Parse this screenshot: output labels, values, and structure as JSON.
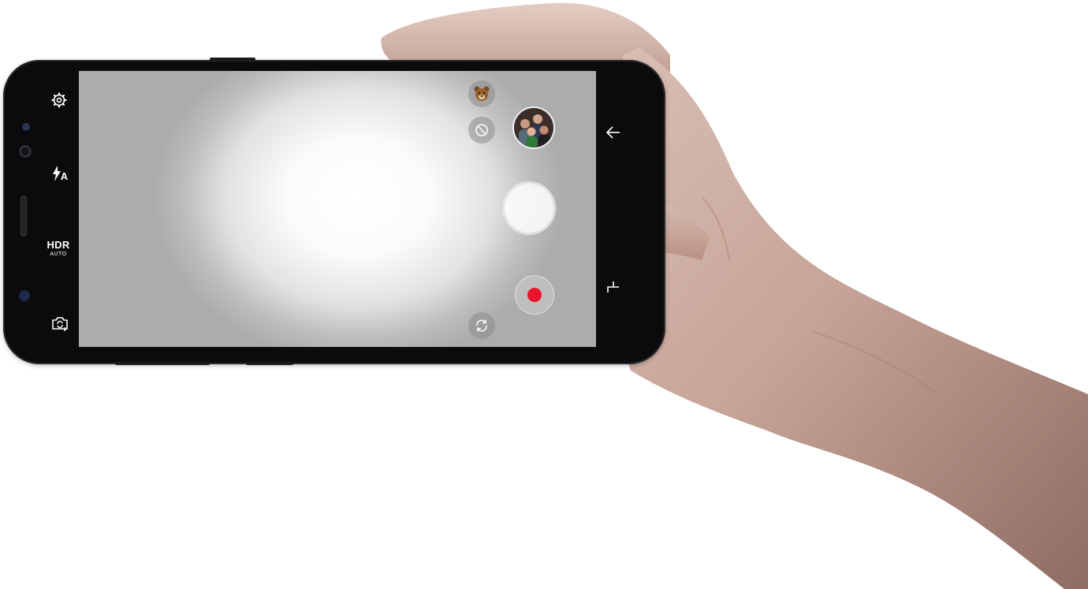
{
  "camera_ui": {
    "settings": {
      "icon": "gear-icon"
    },
    "flash": {
      "icon": "flash-icon",
      "mode_label": "A"
    },
    "hdr": {
      "label": "HDR",
      "mode": "AUTO"
    },
    "switch_camera": {
      "icon": "camera-switch-icon"
    },
    "stickers": {
      "icon": "bear-sticker-icon"
    },
    "filter": {
      "icon": "filter-icon"
    },
    "gallery_thumbnail": {
      "icon": "gallery-thumbnail"
    },
    "shutter": {
      "icon": "shutter-button"
    },
    "record": {
      "icon": "record-button",
      "color": "#e8162b"
    },
    "rotate": {
      "icon": "rotate-icon"
    }
  },
  "navigation": {
    "back": {
      "icon": "back-arrow-icon"
    },
    "recents": {
      "icon": "recents-icon"
    }
  },
  "colors": {
    "phone_body": "#0b0b0d",
    "skin": "#c9a89a",
    "record_red": "#e8162b"
  }
}
